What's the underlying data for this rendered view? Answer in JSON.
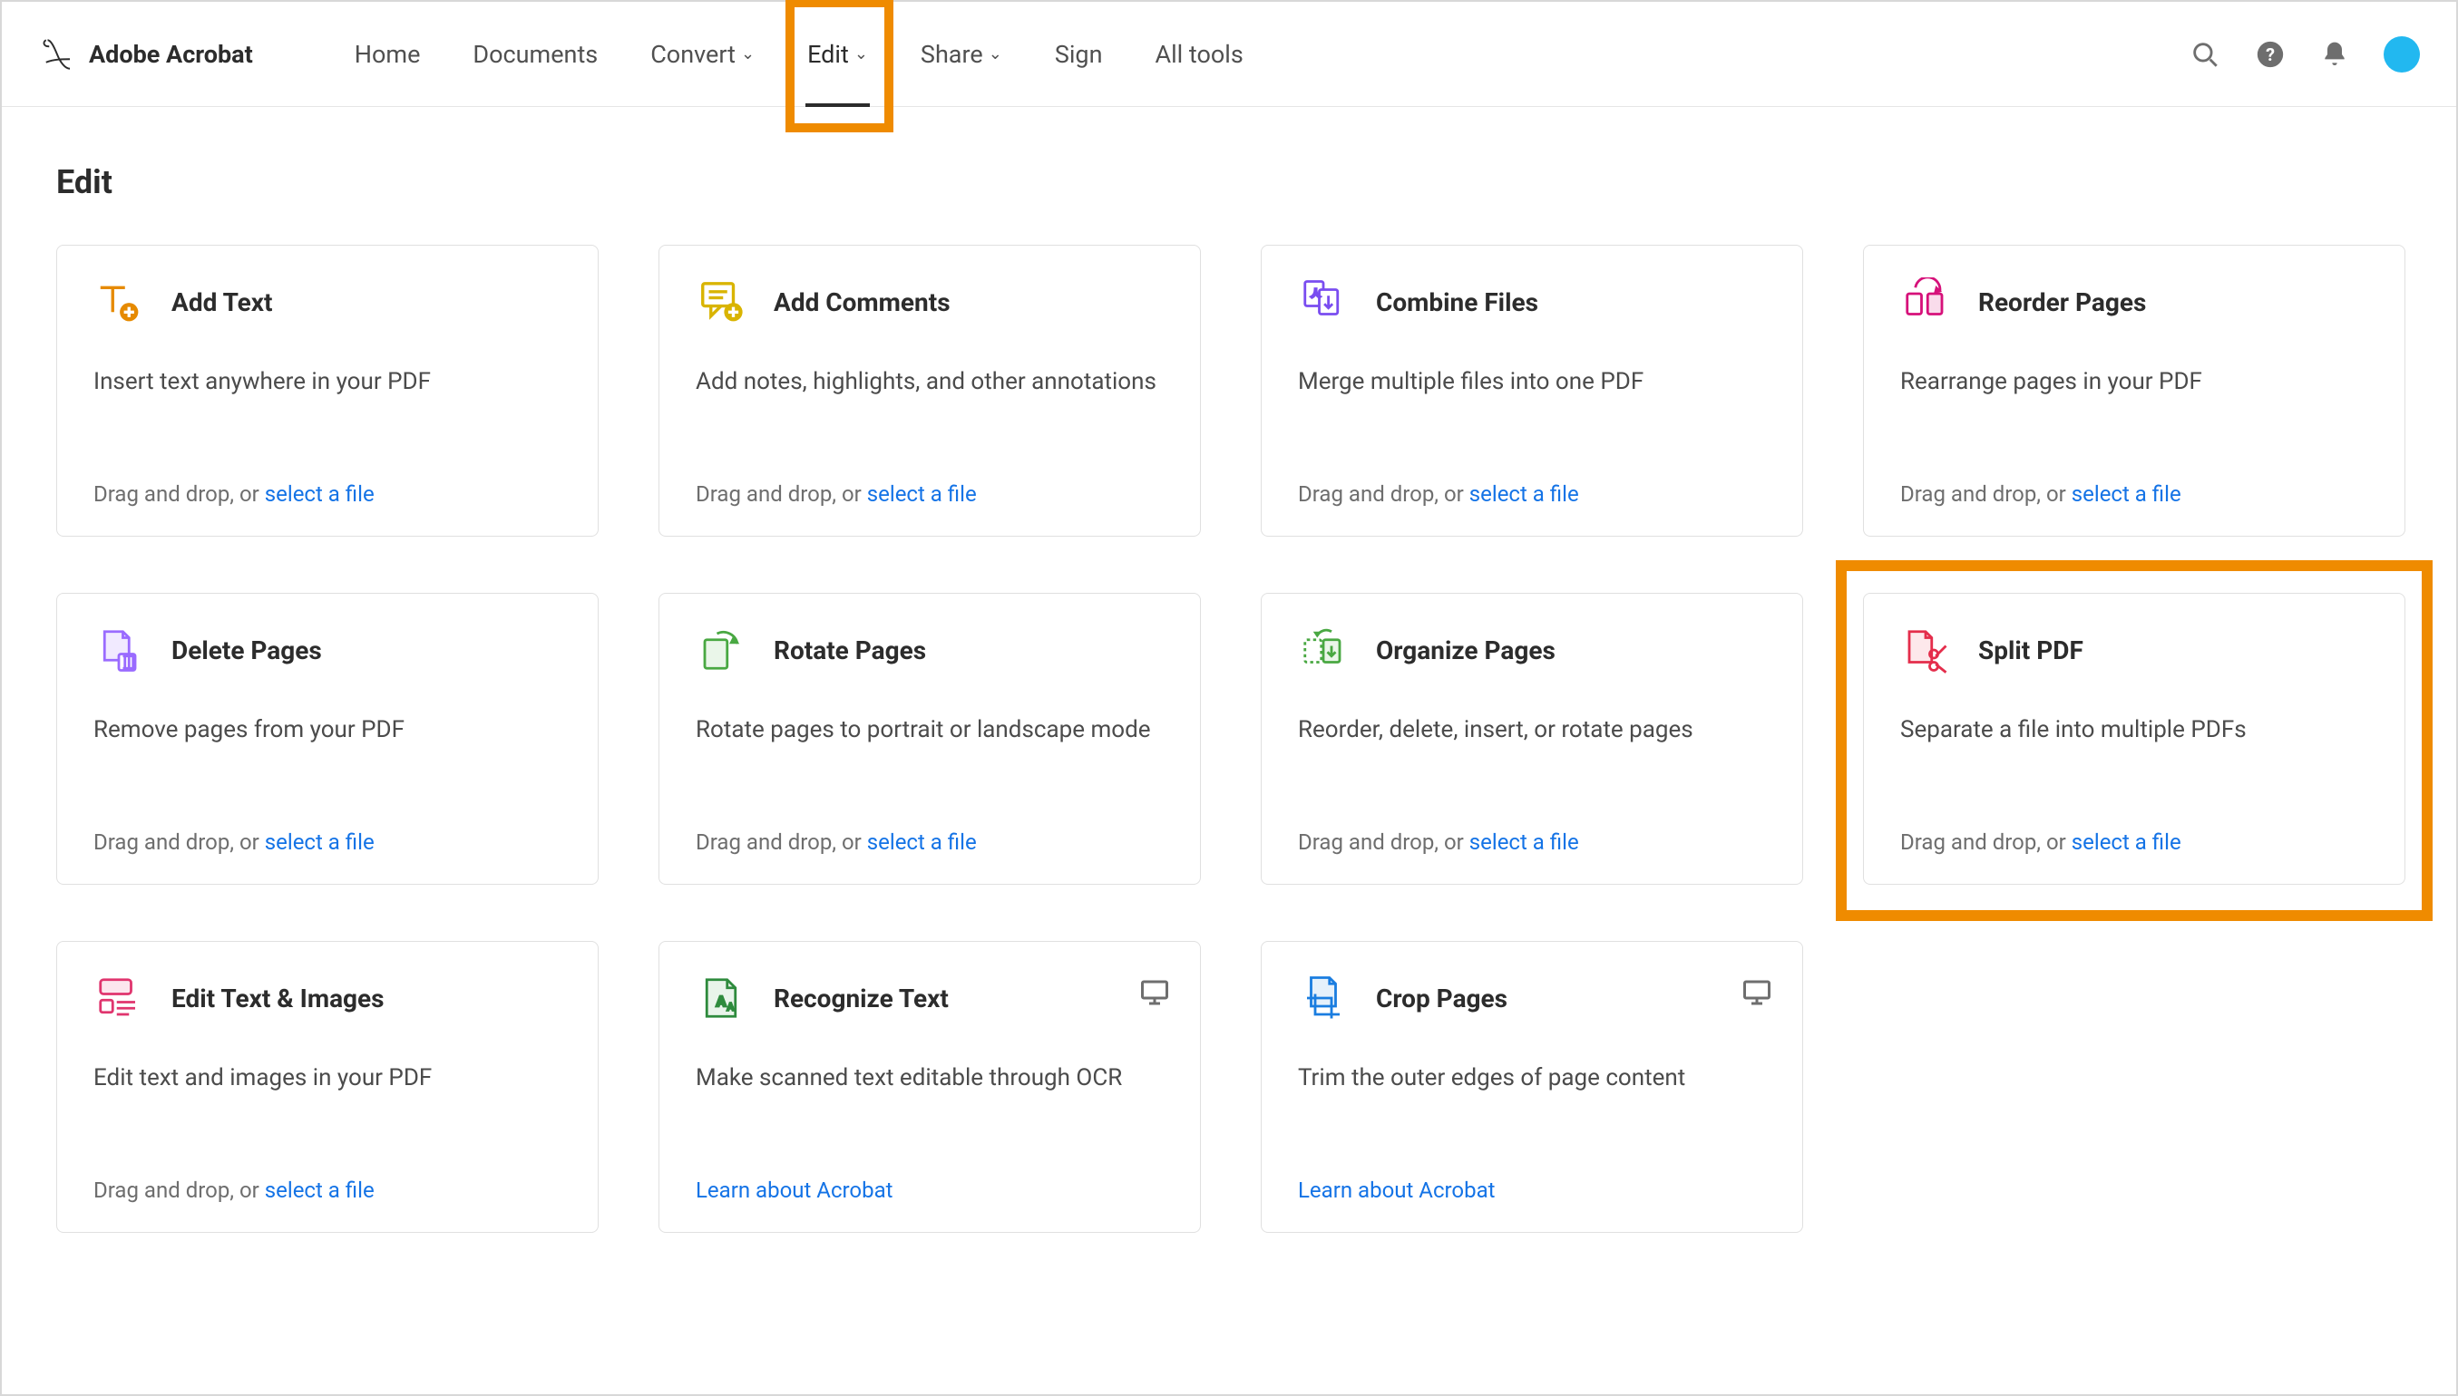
{
  "header": {
    "brand": "Adobe Acrobat",
    "nav": {
      "home": "Home",
      "documents": "Documents",
      "convert": "Convert",
      "edit": "Edit",
      "share": "Share",
      "sign": "Sign",
      "all_tools": "All tools"
    }
  },
  "page": {
    "title": "Edit"
  },
  "common": {
    "drag_drop_prefix": "Drag and drop, or ",
    "select_file": "select a file",
    "learn_acrobat": "Learn about Acrobat"
  },
  "cards": {
    "add_text": {
      "title": "Add Text",
      "desc": "Insert text anywhere in your PDF"
    },
    "add_comments": {
      "title": "Add Comments",
      "desc": "Add notes, highlights, and other annotations"
    },
    "combine_files": {
      "title": "Combine Files",
      "desc": "Merge multiple files into one PDF"
    },
    "reorder_pages": {
      "title": "Reorder Pages",
      "desc": "Rearrange pages in your PDF"
    },
    "delete_pages": {
      "title": "Delete Pages",
      "desc": "Remove pages from your PDF"
    },
    "rotate_pages": {
      "title": "Rotate Pages",
      "desc": "Rotate pages to portrait or landscape mode"
    },
    "organize_pages": {
      "title": "Organize Pages",
      "desc": "Reorder, delete, insert, or rotate pages"
    },
    "split_pdf": {
      "title": "Split PDF",
      "desc": "Separate a file into multiple PDFs"
    },
    "edit_text_images": {
      "title": "Edit Text & Images",
      "desc": "Edit text and images in your PDF"
    },
    "recognize_text": {
      "title": "Recognize Text",
      "desc": "Make scanned text editable through OCR"
    },
    "crop_pages": {
      "title": "Crop Pages",
      "desc": "Trim the outer edges of page content"
    }
  }
}
